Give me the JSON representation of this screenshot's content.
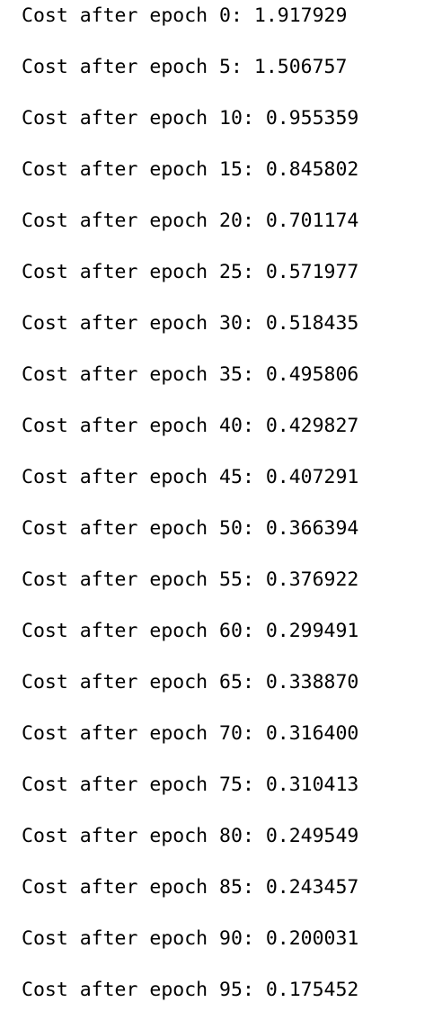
{
  "output": {
    "lines": [
      "Cost after epoch 0: 1.917929",
      "Cost after epoch 5: 1.506757",
      "Cost after epoch 10: 0.955359",
      "Cost after epoch 15: 0.845802",
      "Cost after epoch 20: 0.701174",
      "Cost after epoch 25: 0.571977",
      "Cost after epoch 30: 0.518435",
      "Cost after epoch 35: 0.495806",
      "Cost after epoch 40: 0.429827",
      "Cost after epoch 45: 0.407291",
      "Cost after epoch 50: 0.366394",
      "Cost after epoch 55: 0.376922",
      "Cost after epoch 60: 0.299491",
      "Cost after epoch 65: 0.338870",
      "Cost after epoch 70: 0.316400",
      "Cost after epoch 75: 0.310413",
      "Cost after epoch 80: 0.249549",
      "Cost after epoch 85: 0.243457",
      "Cost after epoch 90: 0.200031",
      "Cost after epoch 95: 0.175452"
    ]
  }
}
